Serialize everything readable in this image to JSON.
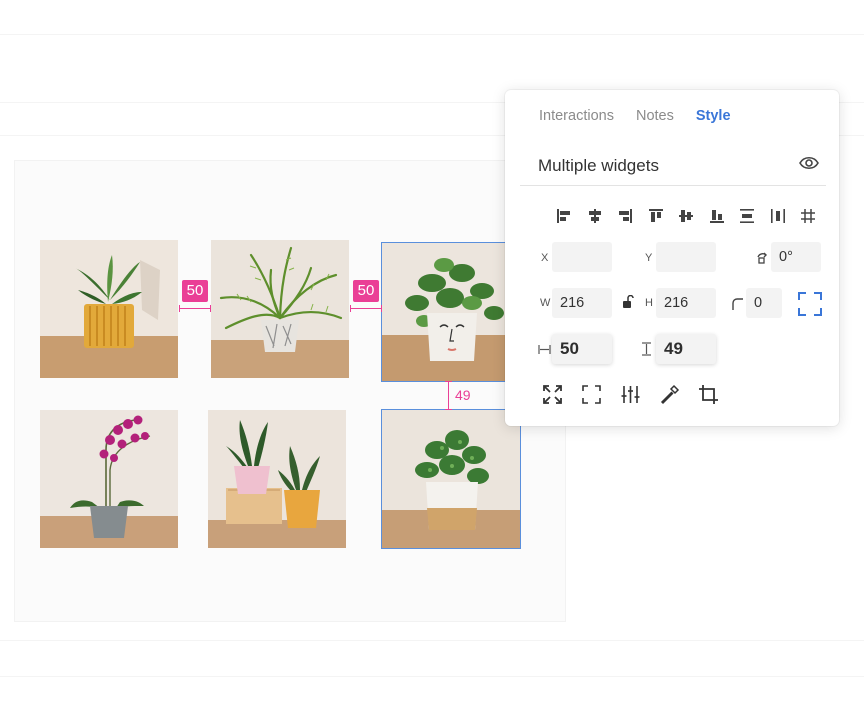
{
  "colors": {
    "accent": "#3a76d8",
    "spacing": "#ea3f96",
    "selection": "#5a8fdc"
  },
  "canvas": {
    "spacing": {
      "gap_one": "50",
      "gap_two": "50",
      "vertical_gap": "49"
    },
    "tiles": [
      {
        "name": "tile-yellow-pot-plant",
        "selected": false
      },
      {
        "name": "tile-fern-white-pot",
        "selected": false
      },
      {
        "name": "tile-face-pot-pothos",
        "selected": true
      },
      {
        "name": "tile-orchid-grey-pot",
        "selected": false
      },
      {
        "name": "tile-snake-plants-pink-orange",
        "selected": false
      },
      {
        "name": "tile-white-gold-pot-plant",
        "selected": true
      }
    ]
  },
  "panel": {
    "tabs": [
      "Interactions",
      "Notes",
      "Style"
    ],
    "active_tab": "Style",
    "title": "Multiple widgets",
    "visibility_icon": "eye-icon",
    "align_icons": [
      "align-left-icon",
      "align-center-horizontal-icon",
      "align-right-icon",
      "align-top-icon",
      "align-middle-vertical-icon",
      "align-bottom-icon",
      "distribute-vertical-icon",
      "distribute-horizontal-icon",
      "tidy-grid-icon"
    ],
    "fields": {
      "x_label": "X",
      "x_value": "",
      "y_label": "Y",
      "y_value": "",
      "rotation_value": "0°",
      "w_label": "W",
      "w_value": "216",
      "h_label": "H",
      "h_value": "216",
      "radius_value": "0",
      "h_spacing_value": "50",
      "v_spacing_value": "49"
    },
    "tool_icons": [
      "fit-to-content-icon",
      "frame-corners-icon",
      "adjust-sliders-icon",
      "eyedropper-icon",
      "crop-icon"
    ]
  }
}
